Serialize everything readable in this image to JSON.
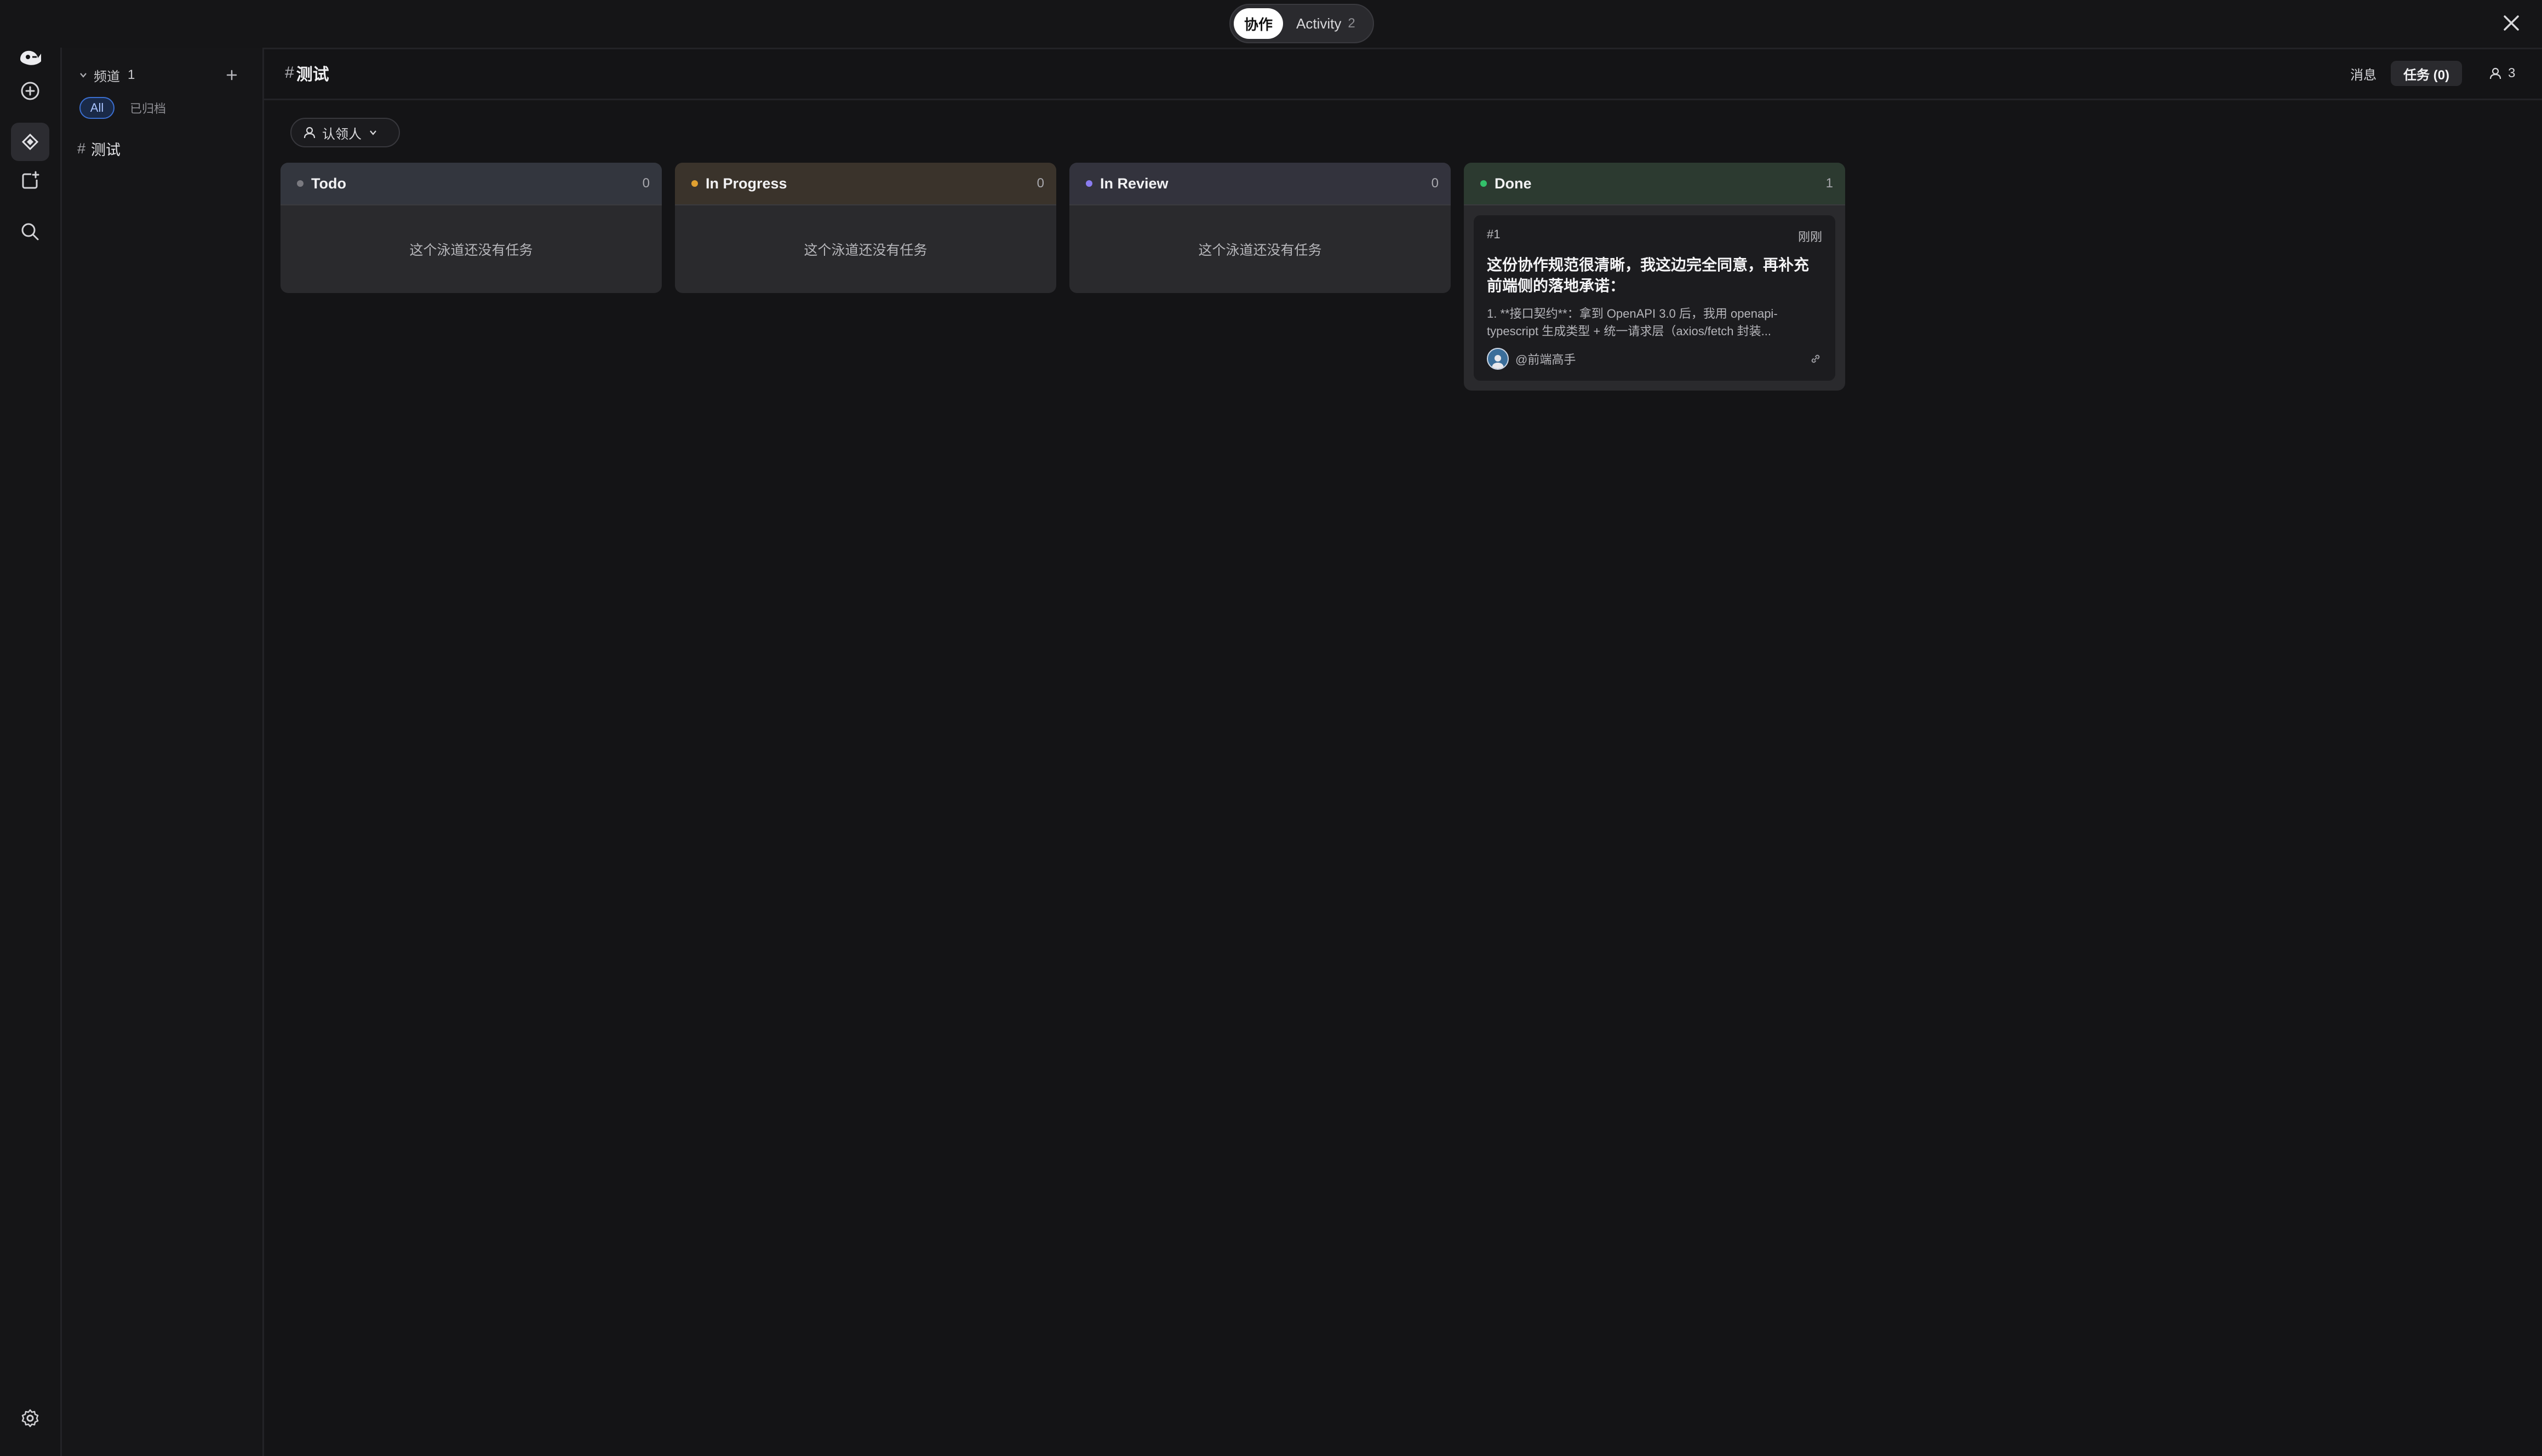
{
  "topbar": {
    "tabs": [
      {
        "label": "协作",
        "active": true
      },
      {
        "label": "Activity",
        "count": "2"
      }
    ]
  },
  "rail": {
    "items": [
      "logo-icon",
      "add-circle-icon",
      "collab-icon",
      "add-square-icon",
      "search-icon"
    ],
    "footer": "gear-icon"
  },
  "sidebar": {
    "section_label": "频道",
    "section_count": "1",
    "filters": {
      "all": "All",
      "archived": "已归档"
    },
    "channels": [
      {
        "hash": "#",
        "name": "测试"
      }
    ]
  },
  "main": {
    "title_hash": "#",
    "title": "测试",
    "tabs": {
      "messages": "消息",
      "tasks": "任务 (0)"
    },
    "members_count": "3",
    "filter_label": "认领人"
  },
  "board": {
    "lanes": [
      {
        "name": "Todo",
        "count": "0",
        "dot_color": "#7a7a80",
        "header_bg": "#33363e",
        "empty_text": "这个泳道还没有任务"
      },
      {
        "name": "In Progress",
        "count": "0",
        "dot_color": "#e0a030",
        "header_bg": "#3a332b",
        "empty_text": "这个泳道还没有任务"
      },
      {
        "name": "In Review",
        "count": "0",
        "dot_color": "#8a7cf0",
        "header_bg": "#33333d",
        "empty_text": "这个泳道还没有任务"
      },
      {
        "name": "Done",
        "count": "1",
        "dot_color": "#33c06a",
        "header_bg": "#2c3a30",
        "card": {
          "id": "#1",
          "time": "刚刚",
          "title": "这份协作规范很清晰，我这边完全同意，再补充前端侧的落地承诺：",
          "desc": "1. **接口契约**：拿到 OpenAPI 3.0 后，我用 openapi-typescript 生成类型 + 统一请求层（axios/fetch 封装...",
          "assignee": "@前端高手"
        }
      }
    ]
  },
  "colors": {
    "background": "#141416",
    "lane": "#2a2a2d",
    "accent": "#3b6fd1"
  }
}
